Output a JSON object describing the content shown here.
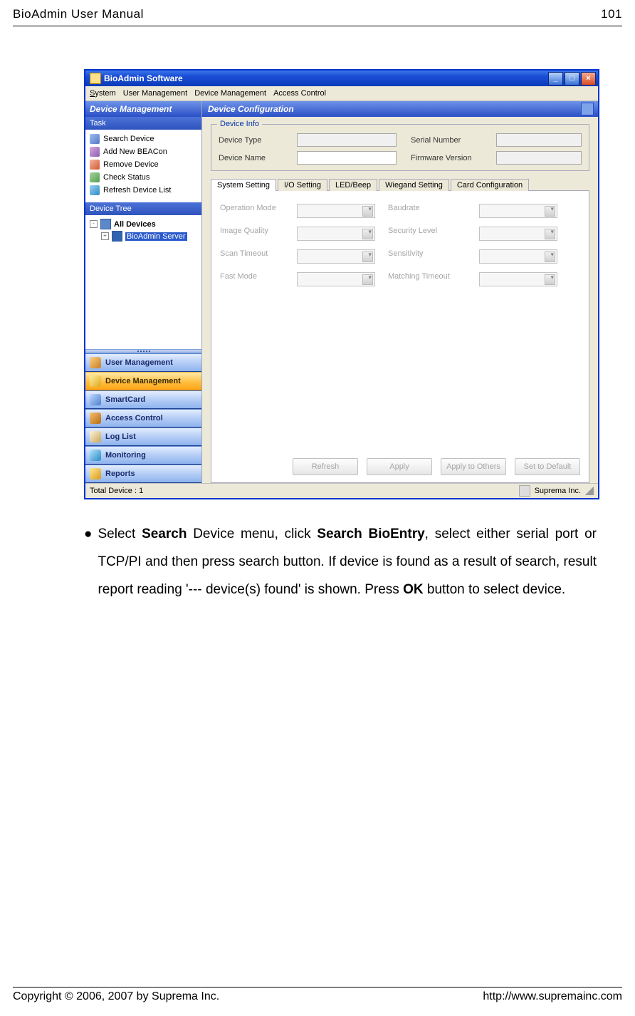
{
  "page": {
    "header_left": "BioAdmin User Manual",
    "header_right": "101",
    "footer_left": "Copyright © 2006, 2007 by Suprema Inc.",
    "footer_right": "http://www.supremainc.com"
  },
  "app": {
    "title": "BioAdmin Software",
    "menubar": [
      "System",
      "User Management",
      "Device Management",
      "Access Control"
    ],
    "left_panel_title": "Device Management",
    "task_header": "Task",
    "tasks": [
      "Search Device",
      "Add New BEACon",
      "Remove Device",
      "Check Status",
      "Refresh Device List"
    ],
    "tree_header": "Device Tree",
    "tree_root": "All Devices",
    "tree_child": "BioAdmin Server",
    "nav": [
      "User Management",
      "Device Management",
      "SmartCard",
      "Access Control",
      "Log List",
      "Monitoring",
      "Reports"
    ],
    "nav_active_index": 1,
    "right_title": "Device Configuration",
    "device_info": {
      "group": "Device Info",
      "device_type_label": "Device Type",
      "device_name_label": "Device Name",
      "serial_label": "Serial Number",
      "firmware_label": "Firmware Version"
    },
    "tabs": [
      "System Setting",
      "I/O Setting",
      "LED/Beep",
      "Wiegand Setting",
      "Card Configuration"
    ],
    "tabs_active": 0,
    "settings": {
      "operation_mode": "Operation Mode",
      "image_quality": "Image Quality",
      "scan_timeout": "Scan Timeout",
      "fast_mode": "Fast Mode",
      "baudrate": "Baudrate",
      "security_level": "Security Level",
      "sensitivity": "Sensitivity",
      "matching_timeout": "Matching Timeout"
    },
    "buttons": [
      "Refresh",
      "Apply",
      "Apply to Others",
      "Set to Default"
    ],
    "status_left": "Total Device : 1",
    "status_right": "Suprema Inc."
  },
  "body": {
    "text_pre": "Select ",
    "strong1": "Search",
    "text_mid1": " Device menu, click ",
    "strong2": "Search BioEntry",
    "text_mid2": ", select either serial port or TCP/PI and then press search button. If device is found as a result of search, result report reading '--- device(s) found' is shown. Press ",
    "strong3": "OK",
    "text_end": " button to select device."
  }
}
